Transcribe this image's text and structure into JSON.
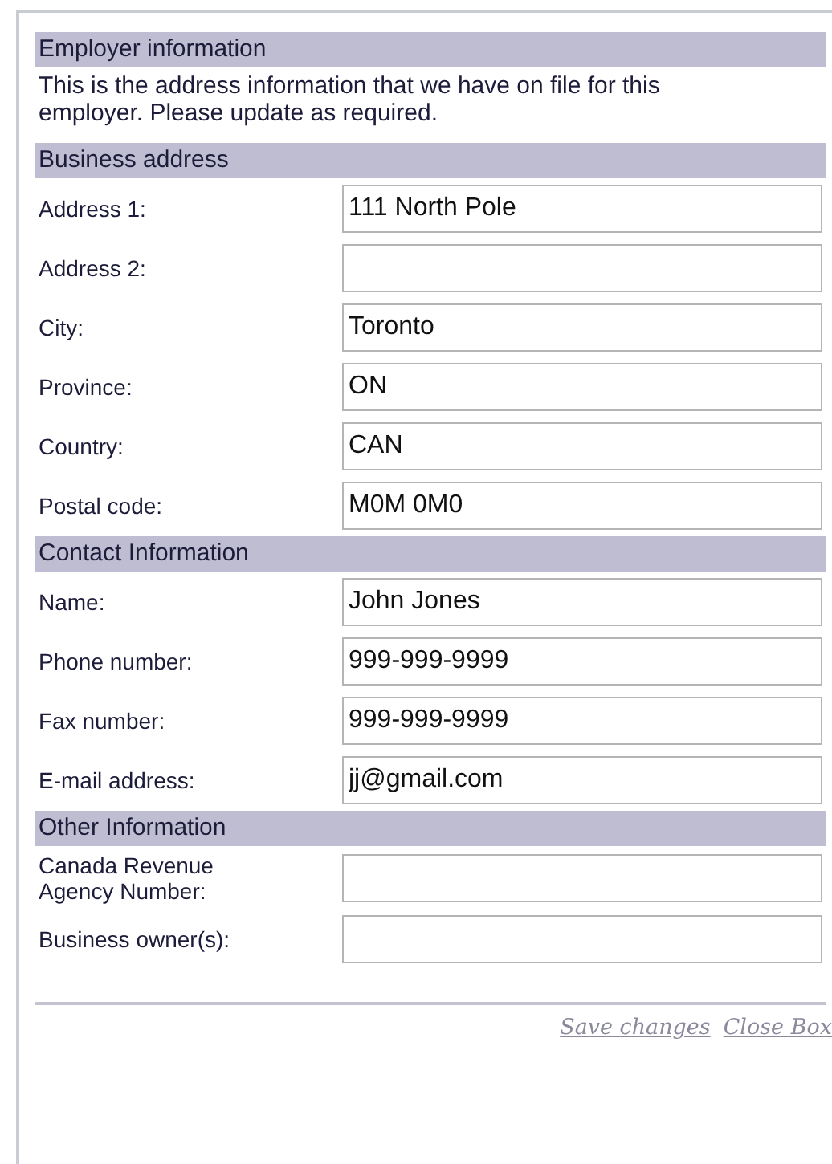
{
  "sections": [
    {
      "title": "Employer information",
      "intro": "This is the address information that we have on file for this employer. Please update as required."
    },
    {
      "title": "Business address",
      "fields": [
        {
          "label": "Address 1:",
          "value": "111 North Pole"
        },
        {
          "label": "Address 2:"
        },
        {
          "label": "City:",
          "value": "Toronto"
        },
        {
          "label": "Province:",
          "value": "ON"
        },
        {
          "label": "Country:",
          "value": "CAN"
        },
        {
          "label": "Postal code:",
          "value": "M0M 0M0"
        }
      ]
    },
    {
      "title": "Contact Information",
      "fields": [
        {
          "label": "Name:",
          "value": "John Jones"
        },
        {
          "label": "Phone number:",
          "value": "999-999-9999"
        },
        {
          "label": "Fax number:",
          "value": "999-999-9999"
        },
        {
          "label": "E-mail address:",
          "value": "jj@gmail.com"
        }
      ]
    },
    {
      "title": "Other Information",
      "fields": [
        {
          "label": "Canada Revenue Agency Number:"
        },
        {
          "label": "Business owner(s):"
        }
      ]
    }
  ],
  "links": [
    "Save changes",
    "Close Box"
  ]
}
